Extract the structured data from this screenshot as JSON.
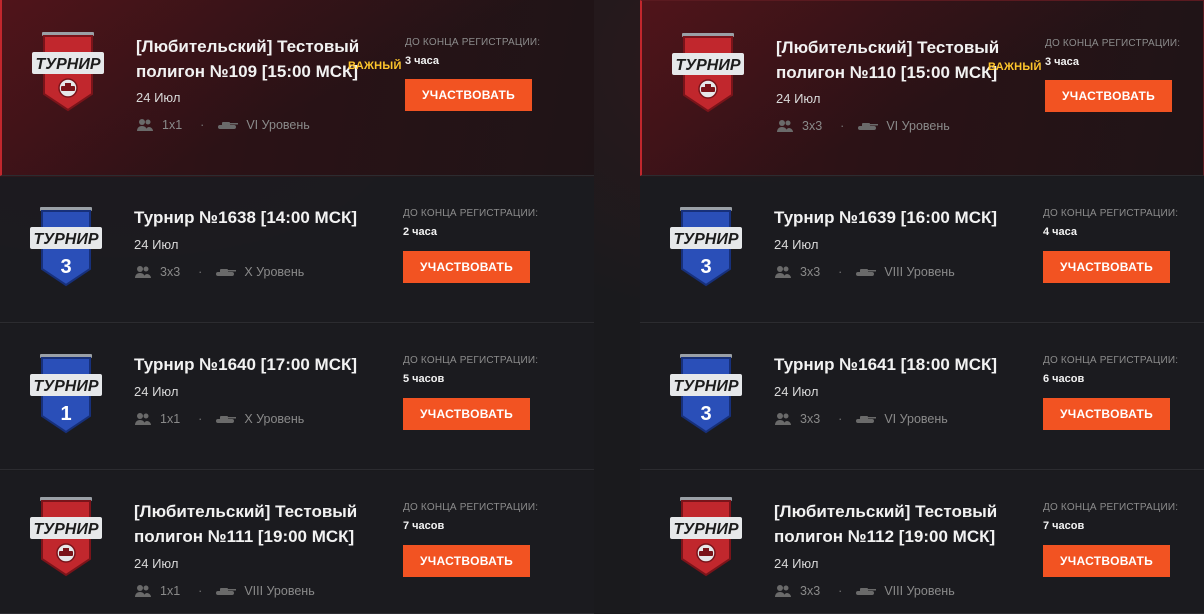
{
  "colors": {
    "accent_button": "#f25322",
    "important_label": "#ffc72c",
    "badge_red": "#c1272d",
    "badge_blue": "#2a4fb8"
  },
  "badge_word": "ТУРНИР",
  "reg_label": "ДО КОНЦА РЕГИСТРАЦИИ:",
  "button_label": "УЧАСТВОВАТЬ",
  "important_label": "ВАЖНЫЙ",
  "tournaments": [
    {
      "title_line1": "[Любительский] Тестовый",
      "title_line2": "полигон №109 [15:00 МСК]",
      "important": true,
      "date": "24 Июл",
      "players": "1x1",
      "tier": "VI Уровень",
      "time_left": "3 часа",
      "badge_color": "red",
      "badge_icon": "tank-emblem-icon",
      "badge_text": ""
    },
    {
      "title_line1": "[Любительский] Тестовый",
      "title_line2": "полигон №110 [15:00 МСК]",
      "important": true,
      "date": "24 Июл",
      "players": "3x3",
      "tier": "VI Уровень",
      "time_left": "3 часа",
      "badge_color": "red",
      "badge_icon": "tank-emblem-icon",
      "badge_text": ""
    },
    {
      "title_line1": "Турнир №1638 [14:00 МСК]",
      "title_line2": "",
      "important": false,
      "date": "24 Июл",
      "players": "3x3",
      "tier": "X Уровень",
      "time_left": "2 часа",
      "badge_color": "blue",
      "badge_icon": "",
      "badge_text": "3"
    },
    {
      "title_line1": "Турнир №1639 [16:00 МСК]",
      "title_line2": "",
      "important": false,
      "date": "24 Июл",
      "players": "3x3",
      "tier": "VIII Уровень",
      "time_left": "4 часа",
      "badge_color": "blue",
      "badge_icon": "",
      "badge_text": "3"
    },
    {
      "title_line1": "Турнир №1640 [17:00 МСК]",
      "title_line2": "",
      "important": false,
      "date": "24 Июл",
      "players": "1x1",
      "tier": "X Уровень",
      "time_left": "5 часов",
      "badge_color": "blue",
      "badge_icon": "",
      "badge_text": "1"
    },
    {
      "title_line1": "Турнир №1641 [18:00 МСК]",
      "title_line2": "",
      "important": false,
      "date": "24 Июл",
      "players": "3x3",
      "tier": "VI Уровень",
      "time_left": "6 часов",
      "badge_color": "blue",
      "badge_icon": "",
      "badge_text": "3"
    },
    {
      "title_line1": "[Любительский] Тестовый",
      "title_line2": "полигон №111 [19:00 МСК]",
      "important": false,
      "date": "24 Июл",
      "players": "1x1",
      "tier": "VIII Уровень",
      "time_left": "7 часов",
      "badge_color": "red",
      "badge_icon": "tank-emblem-icon",
      "badge_text": ""
    },
    {
      "title_line1": "[Любительский] Тестовый",
      "title_line2": "полигон №112 [19:00 МСК]",
      "important": false,
      "date": "24 Июл",
      "players": "3x3",
      "tier": "VIII Уровень",
      "time_left": "7 часов",
      "badge_color": "red",
      "badge_icon": "tank-emblem-icon",
      "badge_text": ""
    }
  ]
}
